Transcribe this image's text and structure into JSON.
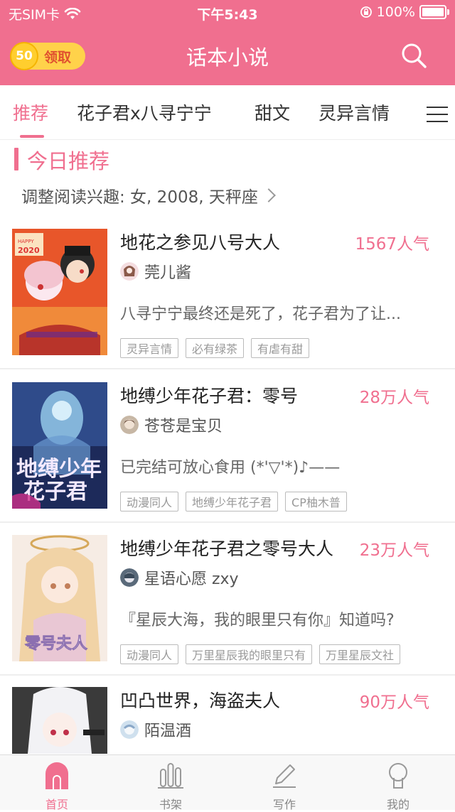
{
  "status_bar": {
    "carrier": "无SIM卡",
    "time": "下午5:43",
    "battery": "100%"
  },
  "header": {
    "coin_amount": "50",
    "coin_label": "领取",
    "title": "话本小说"
  },
  "tabs": [
    {
      "label": "推荐",
      "active": true
    },
    {
      "label": "花子君x八寻宁宁"
    },
    {
      "label": "甜文"
    },
    {
      "label": "灵异言情"
    }
  ],
  "section": {
    "title": "今日推荐",
    "interest": "调整阅读兴趣: 女, 2008, 天秤座"
  },
  "books": [
    {
      "title": "地花之参见八号大人",
      "popularity": "1567人气",
      "author": "莞儿酱",
      "description": "八寻宁宁最终还是死了，花子君为了让...",
      "tags": [
        "灵异言情",
        "必有绿茶",
        "有虐有甜"
      ]
    },
    {
      "title": "地缚少年花子君：零号",
      "popularity": "28万人气",
      "author": "苍苍是宝贝",
      "description": "已完结可放心食用 (*'▽'*)♪——",
      "tags": [
        "动漫同人",
        "地缚少年花子君",
        "CP柚木普"
      ]
    },
    {
      "title": "地缚少年花子君之零号大人",
      "popularity": "23万人气",
      "author": "星语心愿 zxy",
      "description": "『星辰大海，我的眼里只有你』知道吗?",
      "tags": [
        "动漫同人",
        "万里星辰我的眼里只有",
        "万里星辰文社"
      ]
    },
    {
      "title": "凹凸世界，海盗夫人",
      "popularity": "90万人气",
      "author": "陌温酒",
      "description": "",
      "tags": []
    }
  ],
  "bottom_nav": [
    {
      "label": "首页",
      "icon": "home-icon",
      "active": true
    },
    {
      "label": "书架",
      "icon": "bookshelf-icon"
    },
    {
      "label": "写作",
      "icon": "pen-icon"
    },
    {
      "label": "我的",
      "icon": "profile-icon"
    }
  ],
  "colors": {
    "accent": "#f06f8f",
    "coin": "#ffd24a"
  }
}
